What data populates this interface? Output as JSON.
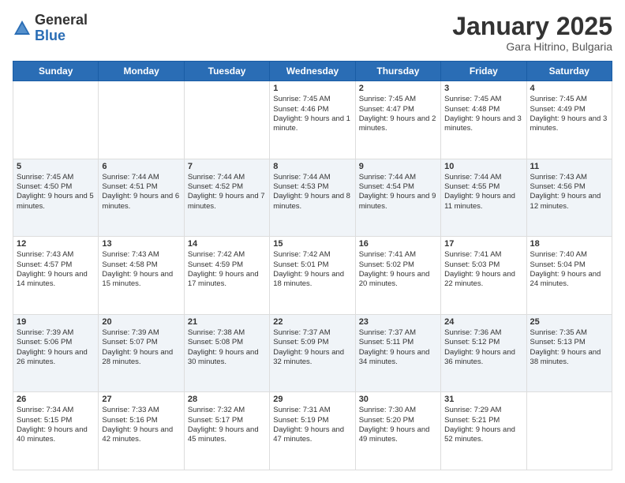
{
  "header": {
    "logo": {
      "general": "General",
      "blue": "Blue"
    },
    "title": "January 2025",
    "location": "Gara Hitrino, Bulgaria"
  },
  "calendar": {
    "days_of_week": [
      "Sunday",
      "Monday",
      "Tuesday",
      "Wednesday",
      "Thursday",
      "Friday",
      "Saturday"
    ],
    "weeks": [
      [
        {
          "day": "",
          "content": ""
        },
        {
          "day": "",
          "content": ""
        },
        {
          "day": "",
          "content": ""
        },
        {
          "day": "1",
          "content": "Sunrise: 7:45 AM\nSunset: 4:46 PM\nDaylight: 9 hours and 1 minute."
        },
        {
          "day": "2",
          "content": "Sunrise: 7:45 AM\nSunset: 4:47 PM\nDaylight: 9 hours and 2 minutes."
        },
        {
          "day": "3",
          "content": "Sunrise: 7:45 AM\nSunset: 4:48 PM\nDaylight: 9 hours and 3 minutes."
        },
        {
          "day": "4",
          "content": "Sunrise: 7:45 AM\nSunset: 4:49 PM\nDaylight: 9 hours and 3 minutes."
        }
      ],
      [
        {
          "day": "5",
          "content": "Sunrise: 7:45 AM\nSunset: 4:50 PM\nDaylight: 9 hours and 5 minutes."
        },
        {
          "day": "6",
          "content": "Sunrise: 7:44 AM\nSunset: 4:51 PM\nDaylight: 9 hours and 6 minutes."
        },
        {
          "day": "7",
          "content": "Sunrise: 7:44 AM\nSunset: 4:52 PM\nDaylight: 9 hours and 7 minutes."
        },
        {
          "day": "8",
          "content": "Sunrise: 7:44 AM\nSunset: 4:53 PM\nDaylight: 9 hours and 8 minutes."
        },
        {
          "day": "9",
          "content": "Sunrise: 7:44 AM\nSunset: 4:54 PM\nDaylight: 9 hours and 9 minutes."
        },
        {
          "day": "10",
          "content": "Sunrise: 7:44 AM\nSunset: 4:55 PM\nDaylight: 9 hours and 11 minutes."
        },
        {
          "day": "11",
          "content": "Sunrise: 7:43 AM\nSunset: 4:56 PM\nDaylight: 9 hours and 12 minutes."
        }
      ],
      [
        {
          "day": "12",
          "content": "Sunrise: 7:43 AM\nSunset: 4:57 PM\nDaylight: 9 hours and 14 minutes."
        },
        {
          "day": "13",
          "content": "Sunrise: 7:43 AM\nSunset: 4:58 PM\nDaylight: 9 hours and 15 minutes."
        },
        {
          "day": "14",
          "content": "Sunrise: 7:42 AM\nSunset: 4:59 PM\nDaylight: 9 hours and 17 minutes."
        },
        {
          "day": "15",
          "content": "Sunrise: 7:42 AM\nSunset: 5:01 PM\nDaylight: 9 hours and 18 minutes."
        },
        {
          "day": "16",
          "content": "Sunrise: 7:41 AM\nSunset: 5:02 PM\nDaylight: 9 hours and 20 minutes."
        },
        {
          "day": "17",
          "content": "Sunrise: 7:41 AM\nSunset: 5:03 PM\nDaylight: 9 hours and 22 minutes."
        },
        {
          "day": "18",
          "content": "Sunrise: 7:40 AM\nSunset: 5:04 PM\nDaylight: 9 hours and 24 minutes."
        }
      ],
      [
        {
          "day": "19",
          "content": "Sunrise: 7:39 AM\nSunset: 5:06 PM\nDaylight: 9 hours and 26 minutes."
        },
        {
          "day": "20",
          "content": "Sunrise: 7:39 AM\nSunset: 5:07 PM\nDaylight: 9 hours and 28 minutes."
        },
        {
          "day": "21",
          "content": "Sunrise: 7:38 AM\nSunset: 5:08 PM\nDaylight: 9 hours and 30 minutes."
        },
        {
          "day": "22",
          "content": "Sunrise: 7:37 AM\nSunset: 5:09 PM\nDaylight: 9 hours and 32 minutes."
        },
        {
          "day": "23",
          "content": "Sunrise: 7:37 AM\nSunset: 5:11 PM\nDaylight: 9 hours and 34 minutes."
        },
        {
          "day": "24",
          "content": "Sunrise: 7:36 AM\nSunset: 5:12 PM\nDaylight: 9 hours and 36 minutes."
        },
        {
          "day": "25",
          "content": "Sunrise: 7:35 AM\nSunset: 5:13 PM\nDaylight: 9 hours and 38 minutes."
        }
      ],
      [
        {
          "day": "26",
          "content": "Sunrise: 7:34 AM\nSunset: 5:15 PM\nDaylight: 9 hours and 40 minutes."
        },
        {
          "day": "27",
          "content": "Sunrise: 7:33 AM\nSunset: 5:16 PM\nDaylight: 9 hours and 42 minutes."
        },
        {
          "day": "28",
          "content": "Sunrise: 7:32 AM\nSunset: 5:17 PM\nDaylight: 9 hours and 45 minutes."
        },
        {
          "day": "29",
          "content": "Sunrise: 7:31 AM\nSunset: 5:19 PM\nDaylight: 9 hours and 47 minutes."
        },
        {
          "day": "30",
          "content": "Sunrise: 7:30 AM\nSunset: 5:20 PM\nDaylight: 9 hours and 49 minutes."
        },
        {
          "day": "31",
          "content": "Sunrise: 7:29 AM\nSunset: 5:21 PM\nDaylight: 9 hours and 52 minutes."
        },
        {
          "day": "",
          "content": ""
        }
      ]
    ]
  }
}
